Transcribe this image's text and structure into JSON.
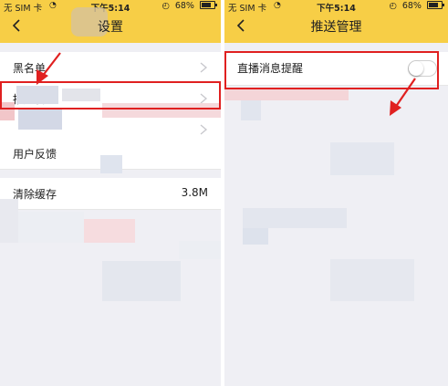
{
  "left_screen": {
    "status": {
      "carrier": "无 SIM 卡",
      "time": "下午5:14",
      "battery": "68%"
    },
    "title": "设置",
    "items": [
      {
        "label": "黑名单"
      },
      {
        "label": "推送管理"
      },
      {
        "label": ""
      },
      {
        "label": "用户反馈"
      },
      {
        "label": "清除缓存",
        "value": "3.8M"
      }
    ]
  },
  "right_screen": {
    "status": {
      "carrier": "无 SIM 卡",
      "time": "下午5:14",
      "battery": "68%"
    },
    "title": "推送管理",
    "items": [
      {
        "label": "直播消息提醒",
        "toggle_on": false
      }
    ]
  },
  "colors": {
    "header": "#f7ce46",
    "highlight": "#e02020"
  },
  "battery_level": 0.68
}
